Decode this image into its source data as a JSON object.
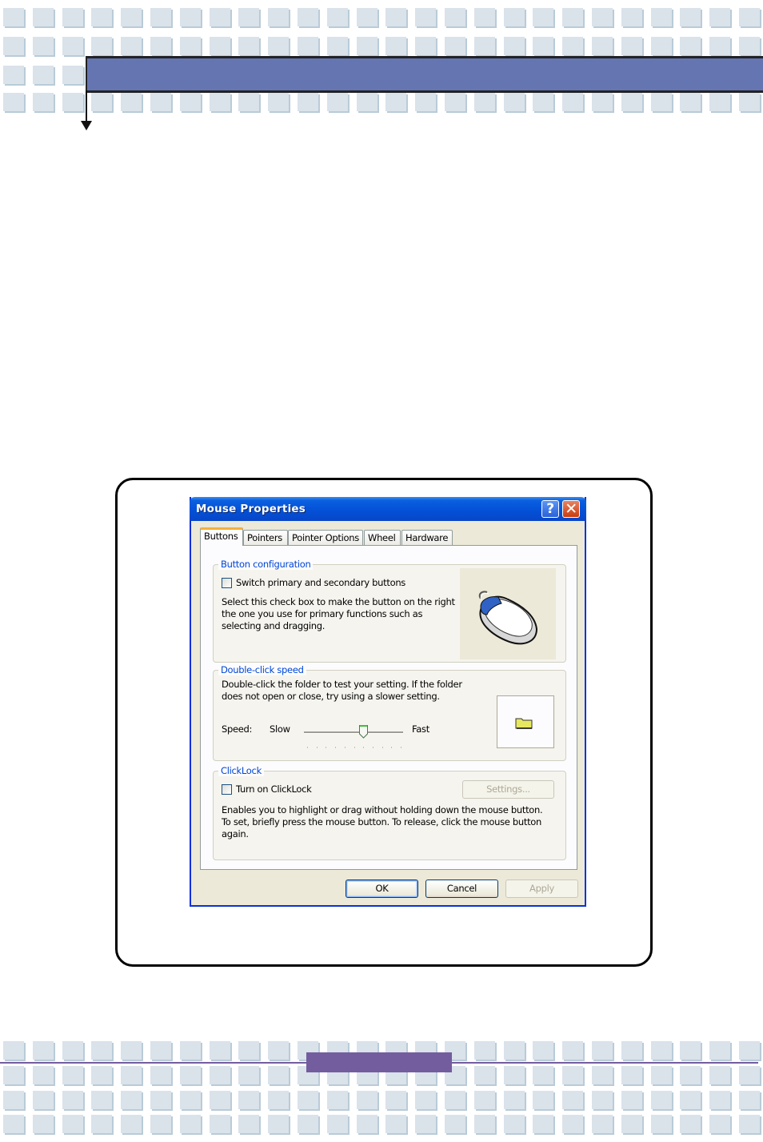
{
  "page": {
    "header_band_color": "#6575b1",
    "footer_accent_color": "#735d9e",
    "tile_color": "#dae2ea"
  },
  "dialog": {
    "title": "Mouse Properties",
    "title_buttons": {
      "help": "?",
      "close": "✕"
    },
    "tabs": [
      {
        "label": "Buttons",
        "active": true
      },
      {
        "label": "Pointers",
        "active": false
      },
      {
        "label": "Pointer Options",
        "active": false
      },
      {
        "label": "Wheel",
        "active": false
      },
      {
        "label": "Hardware",
        "active": false
      }
    ],
    "button_configuration": {
      "group_label": "Button configuration",
      "checkbox_label": "Switch primary and secondary buttons",
      "checked": false,
      "description_lines": [
        "Select this check box to make the button on the right",
        "the one you use for primary functions such as",
        "selecting and dragging."
      ],
      "image_icon": "mouse-icon"
    },
    "double_click_speed": {
      "group_label": "Double-click speed",
      "description_lines": [
        "Double-click the folder to test your setting. If the folder",
        "does not open or close, try using a slower setting."
      ],
      "speed_label": "Speed:",
      "slow_label": "Slow",
      "fast_label": "Fast",
      "slider_value": 6,
      "slider_max": 10,
      "test_icon": "folder-icon"
    },
    "clicklock": {
      "group_label": "ClickLock",
      "checkbox_label": "Turn on ClickLock",
      "checked": false,
      "settings_button": "Settings...",
      "description_lines": [
        "Enables you to highlight or drag without holding down the mouse button.",
        "To set, briefly press the mouse button. To release, click the mouse button",
        "again."
      ]
    },
    "footer_buttons": {
      "ok": "OK",
      "cancel": "Cancel",
      "apply": "Apply"
    }
  }
}
